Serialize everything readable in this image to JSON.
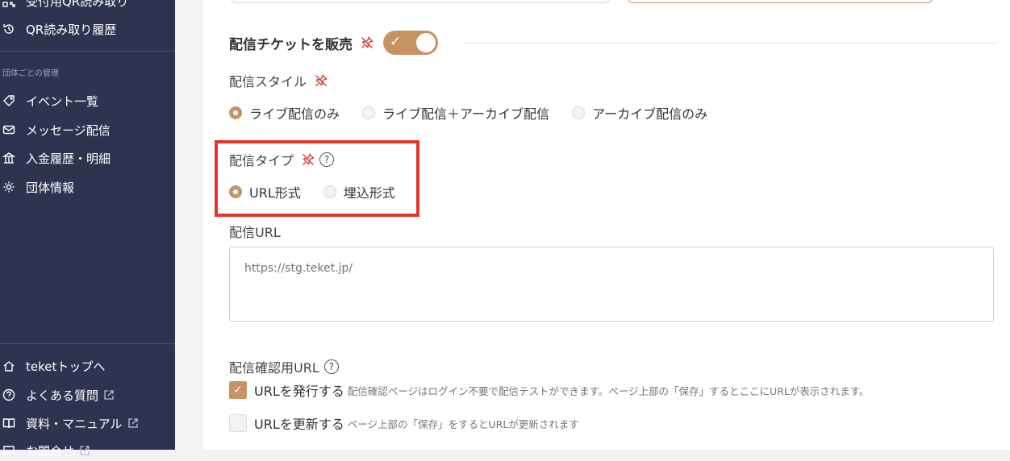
{
  "sidebar": {
    "top_items": [
      {
        "label": "受付用QR読み取り",
        "icon": "qr-icon"
      },
      {
        "label": "QR読み取り履歴",
        "icon": "history-icon"
      }
    ],
    "section_label": "団体ごとの管理",
    "manage_items": [
      {
        "label": "イベント一覧",
        "icon": "tag-icon"
      },
      {
        "label": "メッセージ配信",
        "icon": "mail-icon"
      },
      {
        "label": "入金履歴・明細",
        "icon": "bank-icon"
      },
      {
        "label": "団体情報",
        "icon": "gear-icon"
      }
    ],
    "bottom_items": [
      {
        "label": "teketトップへ",
        "icon": "home-icon"
      },
      {
        "label": "よくある質問",
        "icon": "help-icon"
      },
      {
        "label": "資料・マニュアル",
        "icon": "book-icon"
      },
      {
        "label": "お問合せ",
        "icon": "chat-icon"
      }
    ]
  },
  "main": {
    "sell_stream": {
      "title": "配信チケットを販売",
      "toggle_checked": true
    },
    "stream_style": {
      "label": "配信スタイル",
      "options": [
        "ライブ配信のみ",
        "ライブ配信＋アーカイブ配信",
        "アーカイブ配信のみ"
      ],
      "selected": 0
    },
    "stream_type": {
      "label": "配信タイプ",
      "help": "?",
      "options": [
        "URL形式",
        "埋込形式"
      ],
      "selected": 0
    },
    "stream_url": {
      "label": "配信URL",
      "placeholder": "https://stg.teket.jp/",
      "value": ""
    },
    "confirm_url": {
      "label": "配信確認用URL",
      "help": "?",
      "issue": {
        "label": "URLを発行する",
        "note": "配信確認ページはログイン不要で配信テストができます。ページ上部の「保存」するとここにURLが表示されます。",
        "checked": true
      },
      "update": {
        "label": "URLを更新する",
        "note": "ページ上部の「保存」をするとURLが更新されます",
        "checked": false
      }
    }
  },
  "colors": {
    "accent": "#c89363",
    "sidebar": "#2e3450",
    "highlight": "#e8332a",
    "pin": "#d84a3c"
  }
}
